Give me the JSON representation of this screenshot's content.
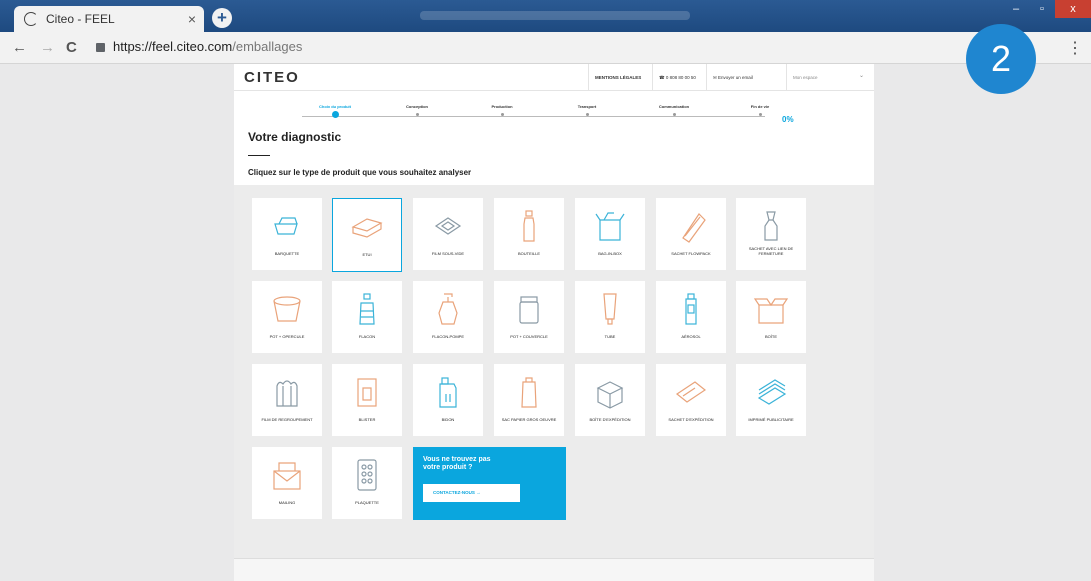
{
  "browser": {
    "tab_title": "Citeo - FEEL",
    "tab_close": "×",
    "new_tab": "+",
    "url_prefix": "https://feel.citeo.com",
    "url_path": "/emballages",
    "back": "←",
    "forward": "→",
    "reload": "C",
    "menu": "⋮"
  },
  "overlay": {
    "step_number": "2"
  },
  "header": {
    "logo": "CITEO",
    "mentions_legales": "MENTIONS LÉGALES",
    "phone": "☎ 0 808 80 00 50",
    "email": "✉ Envoyer un email",
    "space_select": "Mon espace"
  },
  "progress": {
    "steps": [
      "Choix du produit",
      "Conception",
      "Production",
      "Transport",
      "Communication",
      "Fin de vie"
    ],
    "active_index": 0,
    "percent": "0%"
  },
  "main": {
    "title": "Votre diagnostic",
    "instruction": "Cliquez sur le type de produit que vous souhaitez analyser"
  },
  "products": [
    {
      "label": "BARQUETTE",
      "icon": "tray-icon",
      "color": "#3bb3d8"
    },
    {
      "label": "ETUI",
      "icon": "box-case-icon",
      "color": "#e9a37a",
      "selected": true
    },
    {
      "label": "FILM SOUS-VIDE",
      "icon": "vacuum-film-icon",
      "color": "#8a9aa5"
    },
    {
      "label": "BOUTEILLE",
      "icon": "bottle-icon",
      "color": "#e9a37a"
    },
    {
      "label": "BAG-IN-BOX",
      "icon": "bag-in-box-icon",
      "color": "#3bb3d8"
    },
    {
      "label": "SACHET FLOWPACK",
      "icon": "flowpack-icon",
      "color": "#e9a37a"
    },
    {
      "label": "SACHET AVEC LIEN DE FERMETURE",
      "icon": "tied-bag-icon",
      "color": "#8a9aa5"
    },
    {
      "label": "POT + OPERCULE",
      "icon": "pot-lid-icon",
      "color": "#e9a37a"
    },
    {
      "label": "FLACON",
      "icon": "flask-icon",
      "color": "#3bb3d8"
    },
    {
      "label": "FLACON-POMPE",
      "icon": "pump-bottle-icon",
      "color": "#e9a37a"
    },
    {
      "label": "POT + COUVERCLE",
      "icon": "jar-icon",
      "color": "#8a9aa5"
    },
    {
      "label": "TUBE",
      "icon": "tube-icon",
      "color": "#e9a37a"
    },
    {
      "label": "AÉROSOL",
      "icon": "aerosol-icon",
      "color": "#3bb3d8"
    },
    {
      "label": "BOÎTE",
      "icon": "carton-box-icon",
      "color": "#e9a37a"
    },
    {
      "label": "FILM DE REGROUPEMENT",
      "icon": "grouping-film-icon",
      "color": "#8a9aa5"
    },
    {
      "label": "BLISTER",
      "icon": "blister-icon",
      "color": "#e9a37a"
    },
    {
      "label": "BIDON",
      "icon": "jerrycan-icon",
      "color": "#3bb3d8"
    },
    {
      "label": "SAC PAPIER GROS OEUVRE",
      "icon": "paper-sack-icon",
      "color": "#e9a37a"
    },
    {
      "label": "BOÎTE D'EXPÉDITION",
      "icon": "shipping-box-icon",
      "color": "#8a9aa5"
    },
    {
      "label": "SACHET D'EXPÉDITION",
      "icon": "shipping-envelope-icon",
      "color": "#e9a37a"
    },
    {
      "label": "IMPRIMÉ PUBLICITAIRE",
      "icon": "flyer-stack-icon",
      "color": "#3bb3d8"
    },
    {
      "label": "MAILING",
      "icon": "mailing-icon",
      "color": "#e9a37a"
    },
    {
      "label": "PLAQUETTE",
      "icon": "pill-blister-icon",
      "color": "#8a9aa5"
    }
  ],
  "cta": {
    "title_line1": "Vous ne trouvez pas",
    "title_line2": "votre produit ?",
    "button": "CONTACTEZ-NOUS →"
  }
}
